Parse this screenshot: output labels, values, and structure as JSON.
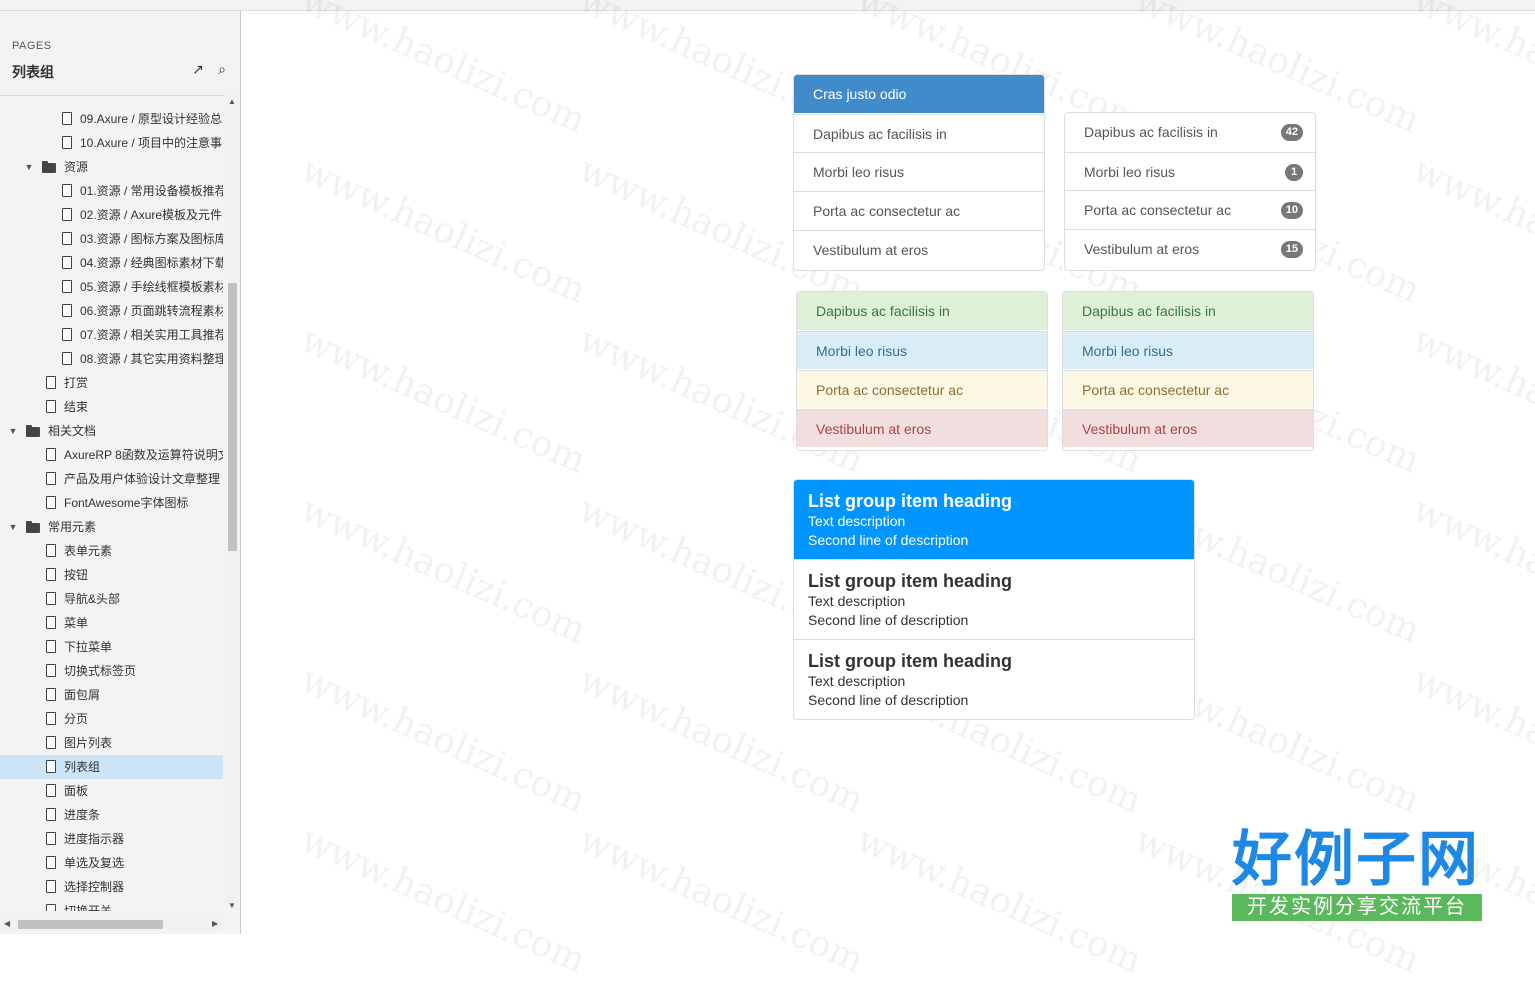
{
  "sidebar": {
    "pages_label": "PAGES",
    "title": "列表组",
    "tree": [
      {
        "label": "09.Axure / 原型设计经验总",
        "type": "page",
        "level": 3
      },
      {
        "label": "10.Axure / 项目中的注意事",
        "type": "page",
        "level": 3
      },
      {
        "label": "资源",
        "type": "folder",
        "level": 2
      },
      {
        "label": "01.资源 / 常用设备模板推荐",
        "type": "page",
        "level": 3
      },
      {
        "label": "02.资源 / Axure模板及元件",
        "type": "page",
        "level": 3
      },
      {
        "label": "03.资源 / 图标方案及图标库",
        "type": "page",
        "level": 3
      },
      {
        "label": "04.资源 / 经典图标素材下载",
        "type": "page",
        "level": 3
      },
      {
        "label": "05.资源 / 手绘线框模板素材",
        "type": "page",
        "level": 3
      },
      {
        "label": "06.资源 / 页面跳转流程素材",
        "type": "page",
        "level": 3
      },
      {
        "label": "07.资源 / 相关实用工具推荐",
        "type": "page",
        "level": 3
      },
      {
        "label": "08.资源 / 其它实用资料整理",
        "type": "page",
        "level": 3
      },
      {
        "label": "打赏",
        "type": "page",
        "level": 2
      },
      {
        "label": "结束",
        "type": "page",
        "level": 2
      },
      {
        "label": "相关文档",
        "type": "folder",
        "level": 1
      },
      {
        "label": "AxureRP 8函数及运算符说明文",
        "type": "page",
        "level": 2
      },
      {
        "label": "产品及用户体验设计文章整理",
        "type": "page",
        "level": 2
      },
      {
        "label": "FontAwesome字体图标",
        "type": "page",
        "level": 2
      },
      {
        "label": "常用元素",
        "type": "folder",
        "level": 1
      },
      {
        "label": "表单元素",
        "type": "page",
        "level": 2
      },
      {
        "label": "按钮",
        "type": "page",
        "level": 2
      },
      {
        "label": "导航&头部",
        "type": "page",
        "level": 2
      },
      {
        "label": "菜单",
        "type": "page",
        "level": 2
      },
      {
        "label": "下拉菜单",
        "type": "page",
        "level": 2
      },
      {
        "label": "切换式标签页",
        "type": "page",
        "level": 2
      },
      {
        "label": "面包屑",
        "type": "page",
        "level": 2
      },
      {
        "label": "分页",
        "type": "page",
        "level": 2
      },
      {
        "label": "图片列表",
        "type": "page",
        "level": 2
      },
      {
        "label": "列表组",
        "type": "page",
        "level": 2,
        "selected": true
      },
      {
        "label": "面板",
        "type": "page",
        "level": 2
      },
      {
        "label": "进度条",
        "type": "page",
        "level": 2
      },
      {
        "label": "进度指示器",
        "type": "page",
        "level": 2
      },
      {
        "label": "单选及复选",
        "type": "page",
        "level": 2
      },
      {
        "label": "选择控制器",
        "type": "page",
        "level": 2
      },
      {
        "label": "切换开关",
        "type": "page",
        "level": 2
      }
    ]
  },
  "basic_group": {
    "active": "Cras justo odio",
    "items": [
      "Dapibus ac facilisis in",
      "Morbi leo risus",
      "Porta ac consectetur ac",
      "Vestibulum at eros"
    ]
  },
  "badge_group": {
    "items": [
      {
        "label": "Dapibus ac facilisis in",
        "badge": "42"
      },
      {
        "label": "Morbi leo risus",
        "badge": "1"
      },
      {
        "label": "Porta ac consectetur ac",
        "badge": "10"
      },
      {
        "label": "Vestibulum at eros",
        "badge": "15"
      }
    ]
  },
  "context_group_a": {
    "items": [
      "Dapibus ac facilisis in",
      "Morbi leo risus",
      "Porta ac consectetur ac",
      "Vestibulum at eros"
    ]
  },
  "context_group_b": {
    "items": [
      "Dapibus ac facilisis in",
      "Morbi leo risus",
      "Porta ac consectetur ac",
      "Vestibulum at eros"
    ]
  },
  "heading_group": {
    "items": [
      {
        "heading": "List group item heading",
        "line1": "Text description",
        "line2": "Second line of description",
        "active": true
      },
      {
        "heading": "List group item heading",
        "line1": "Text description",
        "line2": "Second line of description"
      },
      {
        "heading": "List group item heading",
        "line1": "Text description",
        "line2": "Second line of description"
      }
    ]
  },
  "watermark": "www.haolizi.com",
  "logo": {
    "main": "好例子网",
    "sub": "开发实例分享交流平台"
  },
  "colors": {
    "primary": "#428bca",
    "active_bright": "#0095ff",
    "success": "#dff0d8",
    "info": "#d9edf7",
    "warning": "#fcf8e3",
    "danger": "#f2dede"
  }
}
